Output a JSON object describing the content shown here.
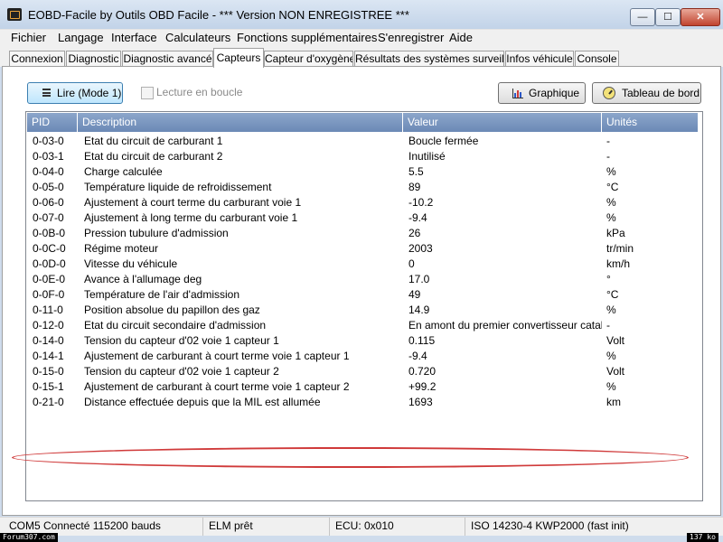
{
  "window": {
    "title": "EOBD-Facile by Outils OBD Facile - *** Version NON ENREGISTREE ***",
    "min_glyph": "—",
    "max_glyph": "☐",
    "close_glyph": "✕"
  },
  "menu": [
    "Fichier",
    "Langage",
    "Interface",
    "Calculateurs",
    "Fonctions supplémentaires",
    "S'enregistrer",
    "Aide"
  ],
  "tabs": [
    "Connexion",
    "Diagnostic",
    "Diagnostic avancé",
    "Capteurs",
    "Capteur d'oxygène",
    "Résultats des systèmes surveillés",
    "Infos véhicule",
    "Console"
  ],
  "active_tab": "Capteurs",
  "toolbar": {
    "read_label": "Lire (Mode 1)",
    "loop_label": "Lecture en boucle",
    "loop_checked": false,
    "graph_label": "Graphique",
    "dashboard_label": "Tableau de bord"
  },
  "table": {
    "headers": {
      "pid": "PID",
      "desc": "Description",
      "value": "Valeur",
      "unit": "Unités"
    },
    "rows": [
      {
        "pid": "0-03-0",
        "desc": "Etat du circuit de carburant 1",
        "value": "Boucle fermée",
        "unit": "-"
      },
      {
        "pid": "0-03-1",
        "desc": "Etat du circuit de carburant 2",
        "value": "Inutilisé",
        "unit": "-"
      },
      {
        "pid": "0-04-0",
        "desc": "Charge calculée",
        "value": "5.5",
        "unit": "%"
      },
      {
        "pid": "0-05-0",
        "desc": "Température liquide de refroidissement",
        "value": "89",
        "unit": "°C"
      },
      {
        "pid": "0-06-0",
        "desc": "Ajustement à court terme du carburant voie 1",
        "value": "-10.2",
        "unit": "%"
      },
      {
        "pid": "0-07-0",
        "desc": "Ajustement à long terme du carburant voie 1",
        "value": "-9.4",
        "unit": "%"
      },
      {
        "pid": "0-0B-0",
        "desc": "Pression tubulure d'admission",
        "value": "26",
        "unit": "kPa"
      },
      {
        "pid": "0-0C-0",
        "desc": "Régime moteur",
        "value": "2003",
        "unit": "tr/min"
      },
      {
        "pid": "0-0D-0",
        "desc": "Vitesse du véhicule",
        "value": "0",
        "unit": "km/h"
      },
      {
        "pid": "0-0E-0",
        "desc": "Avance à l'allumage deg",
        "value": "17.0",
        "unit": "°"
      },
      {
        "pid": "0-0F-0",
        "desc": "Température de l'air d'admission",
        "value": "49",
        "unit": "°C"
      },
      {
        "pid": "0-11-0",
        "desc": "Position absolue du papillon des gaz",
        "value": "14.9",
        "unit": "%"
      },
      {
        "pid": "0-12-0",
        "desc": "Etat du circuit secondaire d'admission",
        "value": "En amont du premier convertisseur cataly...",
        "unit": "-"
      },
      {
        "pid": "0-14-0",
        "desc": "Tension du capteur d'02 voie 1 capteur 1",
        "value": "0.115",
        "unit": "Volt"
      },
      {
        "pid": "0-14-1",
        "desc": "Ajustement de carburant à court terme voie 1 capteur 1",
        "value": "-9.4",
        "unit": "%"
      },
      {
        "pid": "0-15-0",
        "desc": "Tension du capteur d'02 voie 1 capteur 2",
        "value": "0.720",
        "unit": "Volt"
      },
      {
        "pid": "0-15-1",
        "desc": "Ajustement de carburant à court terme voie 1 capteur 2",
        "value": "+99.2",
        "unit": "%"
      },
      {
        "pid": "0-21-0",
        "desc": "Distance effectuée depuis que la MIL est allumée",
        "value": "1693",
        "unit": "km"
      }
    ],
    "highlight_color": "#d03a3a"
  },
  "status": {
    "com": "COM5 Connecté 115200 bauds",
    "elm": "ELM prêt",
    "ecu": "ECU: 0x010",
    "proto": "ISO 14230-4 KWP2000 (fast init)"
  },
  "watermark": {
    "left": "Forum307.com",
    "right": "137 ko"
  }
}
